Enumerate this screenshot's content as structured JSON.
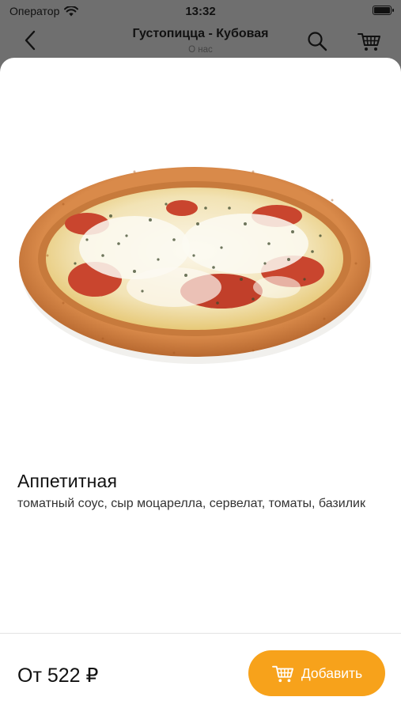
{
  "status_bar": {
    "carrier": "Оператор",
    "time": "13:32",
    "wifi_icon": "wifi-icon",
    "battery_icon": "battery-icon"
  },
  "nav": {
    "title": "Густопицца - Кубовая",
    "subtitle": "О нас",
    "back_icon": "chevron-left-icon",
    "search_icon": "search-icon",
    "cart_icon": "cart-icon"
  },
  "product": {
    "name": "Аппетитная",
    "description": "томатный соус, сыр моцарелла, сервелат, томаты, базилик",
    "image": "pizza-image"
  },
  "footer": {
    "price": "От 522 ₽",
    "add_label": "Добавить",
    "add_icon": "cart-icon"
  },
  "colors": {
    "accent": "#f7a21b",
    "overlay": "#6f6f6f",
    "sheet_bg": "#ffffff"
  }
}
